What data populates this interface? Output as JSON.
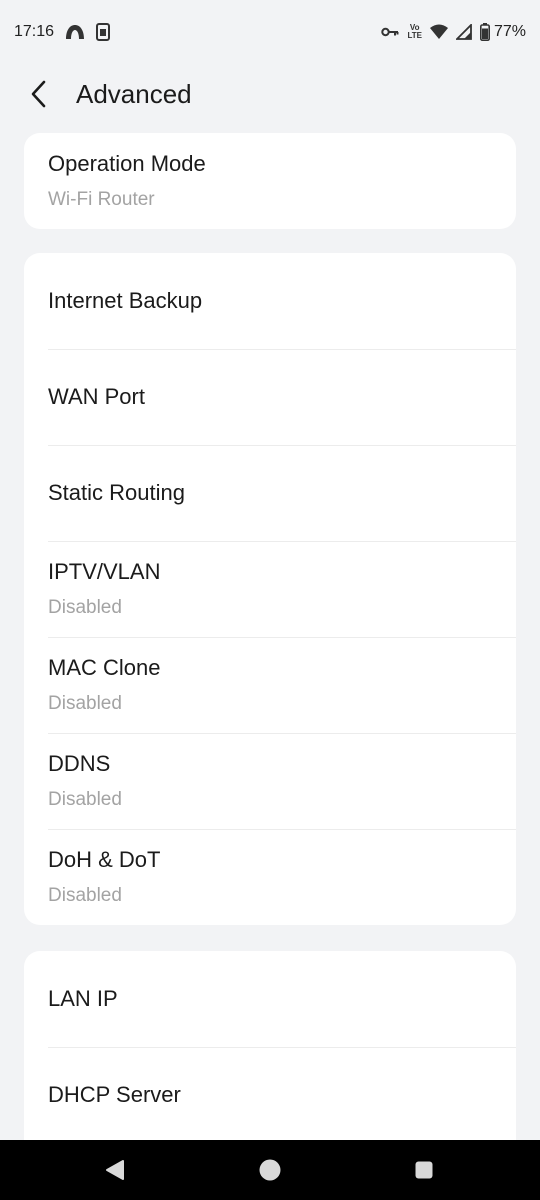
{
  "status_bar": {
    "time": "17:16",
    "battery": "77%",
    "icons_left": [
      "brand-arc-icon",
      "sim-card-icon"
    ],
    "icons_right": [
      "vpn-key-icon",
      "volte-icon",
      "wifi-icon",
      "cell-signal-icon",
      "battery-icon"
    ],
    "volte_text_top": "Vo",
    "volte_text_bottom": "LTE"
  },
  "header": {
    "title": "Advanced"
  },
  "sections": [
    {
      "items": [
        {
          "label": "Operation Mode",
          "value": "Wi-Fi Router"
        }
      ]
    },
    {
      "items": [
        {
          "label": "Internet Backup"
        },
        {
          "label": "WAN Port"
        },
        {
          "label": "Static Routing"
        },
        {
          "label": "IPTV/VLAN",
          "value": "Disabled"
        },
        {
          "label": "MAC Clone",
          "value": "Disabled"
        },
        {
          "label": "DDNS",
          "value": "Disabled"
        },
        {
          "label": "DoH & DoT",
          "value": "Disabled"
        }
      ]
    },
    {
      "items": [
        {
          "label": "LAN IP"
        },
        {
          "label": "DHCP Server"
        }
      ]
    }
  ],
  "colors": {
    "background": "#f2f3f5",
    "card": "#ffffff",
    "secondary_text": "#a3a3a3",
    "nav_bar": "#000000"
  }
}
